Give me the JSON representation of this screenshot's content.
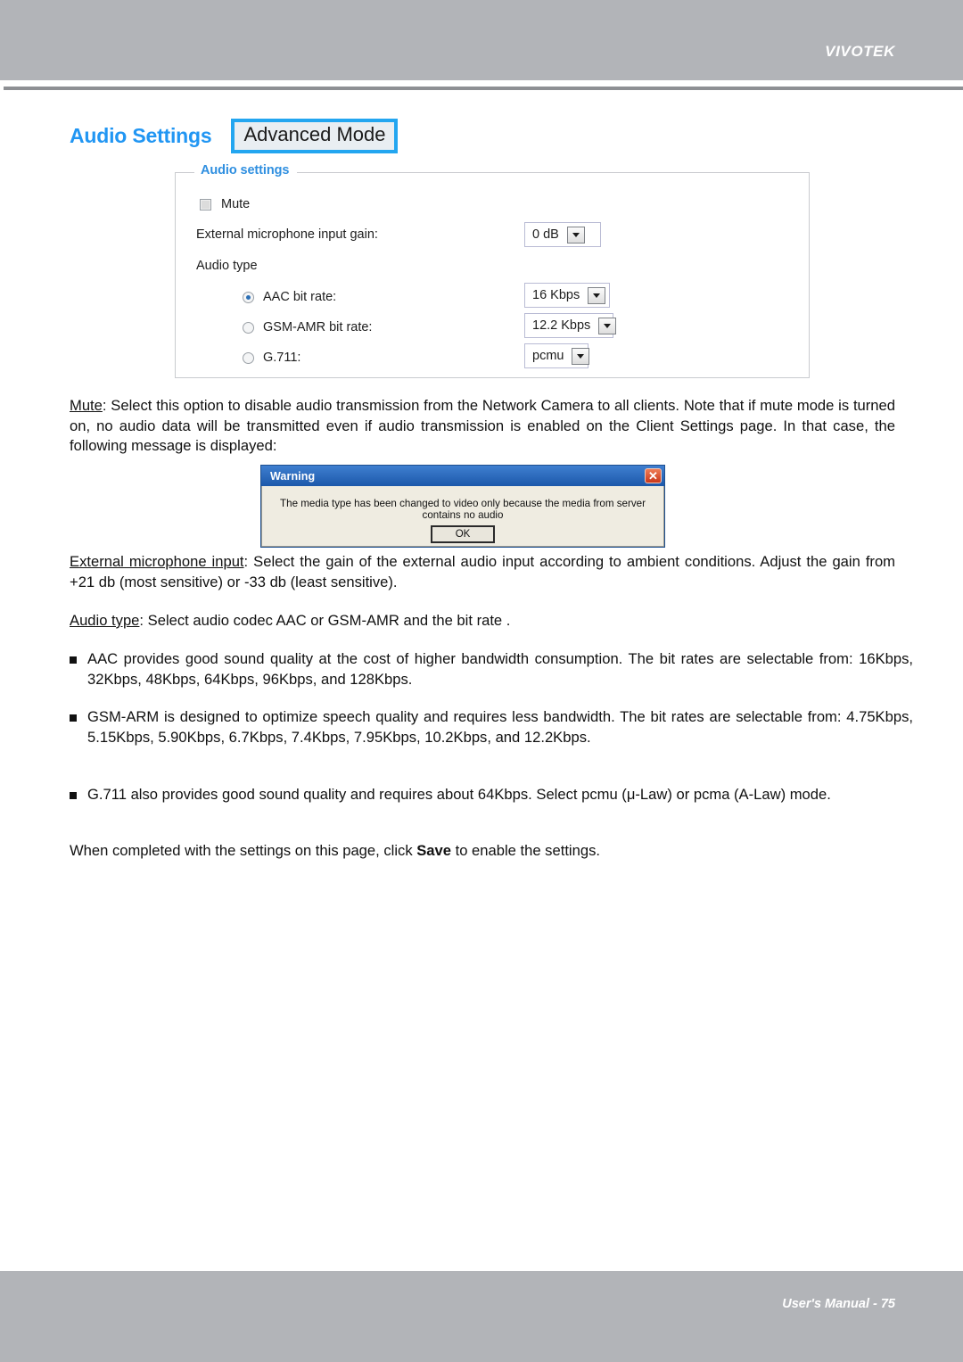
{
  "header": {
    "brand": "VIVOTEK"
  },
  "title_row": {
    "page_title": "Audio Settings",
    "mode_badge": "Advanced Mode"
  },
  "panel": {
    "legend": "Audio settings",
    "mute": {
      "label": "Mute",
      "checked": false
    },
    "mic_gain": {
      "label": "External microphone input gain:",
      "value": "0 dB"
    },
    "audio_type": {
      "label": "Audio type",
      "options": [
        {
          "label": "AAC bit rate:",
          "value": "16 Kbps",
          "selected": true
        },
        {
          "label": "GSM-AMR bit rate:",
          "value": "12.2 Kbps",
          "selected": false
        },
        {
          "label": "G.711:",
          "value": "pcmu",
          "selected": false
        }
      ]
    }
  },
  "body": {
    "mute_para_term": "Mute",
    "mute_para_rest": ": Select this option to disable audio transmission from the Network Camera to all clients. Note that if mute mode is turned on, no audio data will be transmitted even if audio transmission is enabled on the Client Settings page. In that case, the following message is displayed:",
    "mic_para_term": "External microphone input",
    "mic_para_rest": ": Select the gain of the external audio input according to ambient conditions. Adjust the gain from +21 db (most sensitive) or -33 db (least sensitive).",
    "type_para_term": "Audio type",
    "type_para_rest": ": Select audio codec AAC or GSM-AMR and the bit rate .",
    "bullets": [
      "AAC provides good sound quality at the cost of higher bandwidth consumption. The bit rates are selectable from: 16Kbps, 32Kbps, 48Kbps, 64Kbps, 96Kbps, and 128Kbps.",
      "GSM-ARM is designed to optimize speech quality and requires less bandwidth. The bit rates are selectable from: 4.75Kbps, 5.15Kbps, 5.90Kbps, 6.7Kbps, 7.4Kbps, 7.95Kbps, 10.2Kbps, and 12.2Kbps.",
      "G.711 also provides good sound quality and requires about 64Kbps. Select pcmu (μ-Law) or pcma (A-Law) mode."
    ],
    "closing_pre": "When completed with the settings on this page, click ",
    "closing_bold": "Save",
    "closing_post": " to enable the settings."
  },
  "dialog": {
    "title": "Warning",
    "close_glyph": "✕",
    "message": "The media type has been changed to video only because the media from server contains no audio",
    "ok_label": "OK"
  },
  "footer": {
    "text": "User's Manual - 75"
  }
}
